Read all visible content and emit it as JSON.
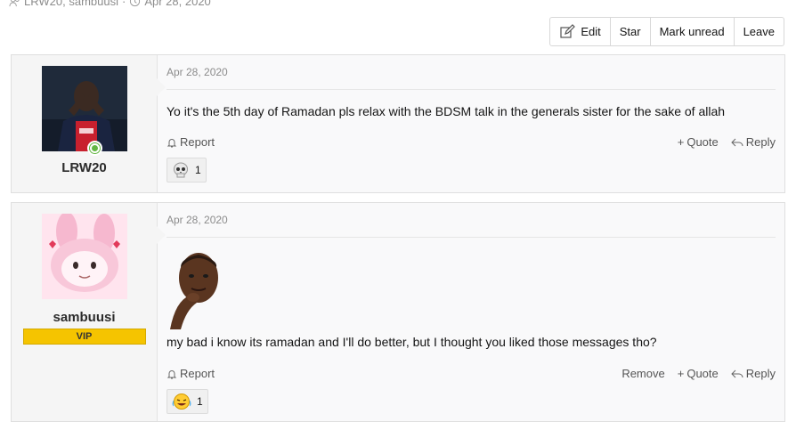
{
  "thread_meta": {
    "participants": "LRW20, sambuusi",
    "date": "Apr 28, 2020"
  },
  "thread_actions": {
    "edit": "Edit",
    "star": "Star",
    "mark_unread": "Mark unread",
    "leave": "Leave"
  },
  "posts": [
    {
      "username": "LRW20",
      "date": "Apr 28, 2020",
      "body": "Yo it's the 5th day of Ramadan pls relax with the BDSM talk in the generals sister for the sake of allah",
      "report": "Report",
      "quote": "Quote",
      "reply": "Reply",
      "reaction_count": "1",
      "reaction_icon": "skull-emoji"
    },
    {
      "username": "sambuusi",
      "badge": "VIP",
      "date": "Apr 28, 2020",
      "body": "my bad i know its ramadan and I'll do better, but I thought you liked those messages tho?",
      "report": "Report",
      "remove": "Remove",
      "quote": "Quote",
      "reply": "Reply",
      "reaction_count": "1",
      "reaction_icon": "laughing-tears-emoji"
    }
  ]
}
